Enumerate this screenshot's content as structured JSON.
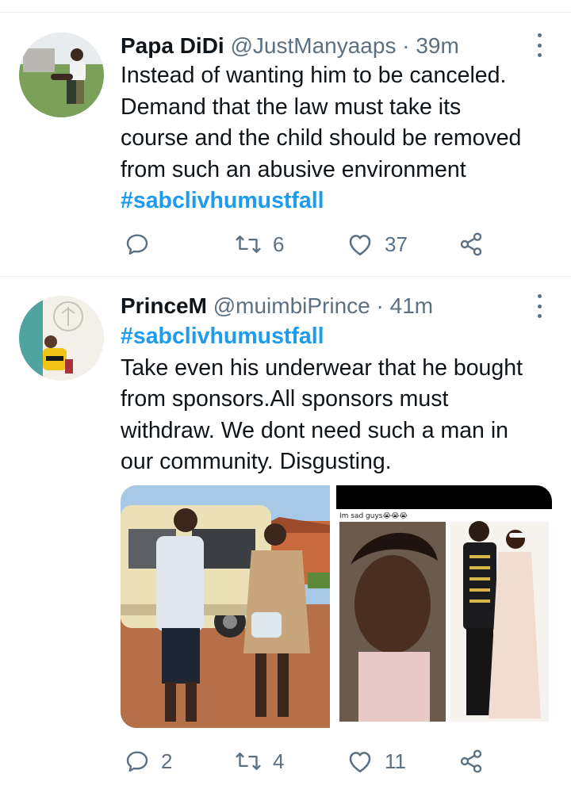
{
  "tweets": [
    {
      "display_name": "Papa DiDi",
      "handle": "@JustManyaaps",
      "separator": "·",
      "time": "39m",
      "lines": [
        "Instead of wanting him to be canceled.",
        "Demand that the law must take its",
        "course and the child should be removed",
        "from such an abusive environment"
      ],
      "hashtag": "#sabclivhumustfall",
      "replies": "",
      "retweets": "6",
      "likes": "37"
    },
    {
      "display_name": "PrinceM",
      "handle": "@muimbiPrince",
      "separator": "·",
      "time": "41m",
      "hashtag": "#sabclivhumustfall",
      "lines": [
        "Take even his underwear that he bought",
        "from sponsors.All sponsors must",
        "withdraw. We dont need such a man in",
        "our community. Disgusting."
      ],
      "media_caption": "Im sad guys😭😭😭",
      "replies": "2",
      "retweets": "4",
      "likes": "11"
    }
  ],
  "icons": [
    "reply-icon",
    "retweet-icon",
    "like-icon",
    "share-icon",
    "more-options-icon"
  ],
  "colors": {
    "hashtag": "#1d9bf0",
    "secondary": "#5b7083",
    "divider": "#e6ecf0"
  }
}
